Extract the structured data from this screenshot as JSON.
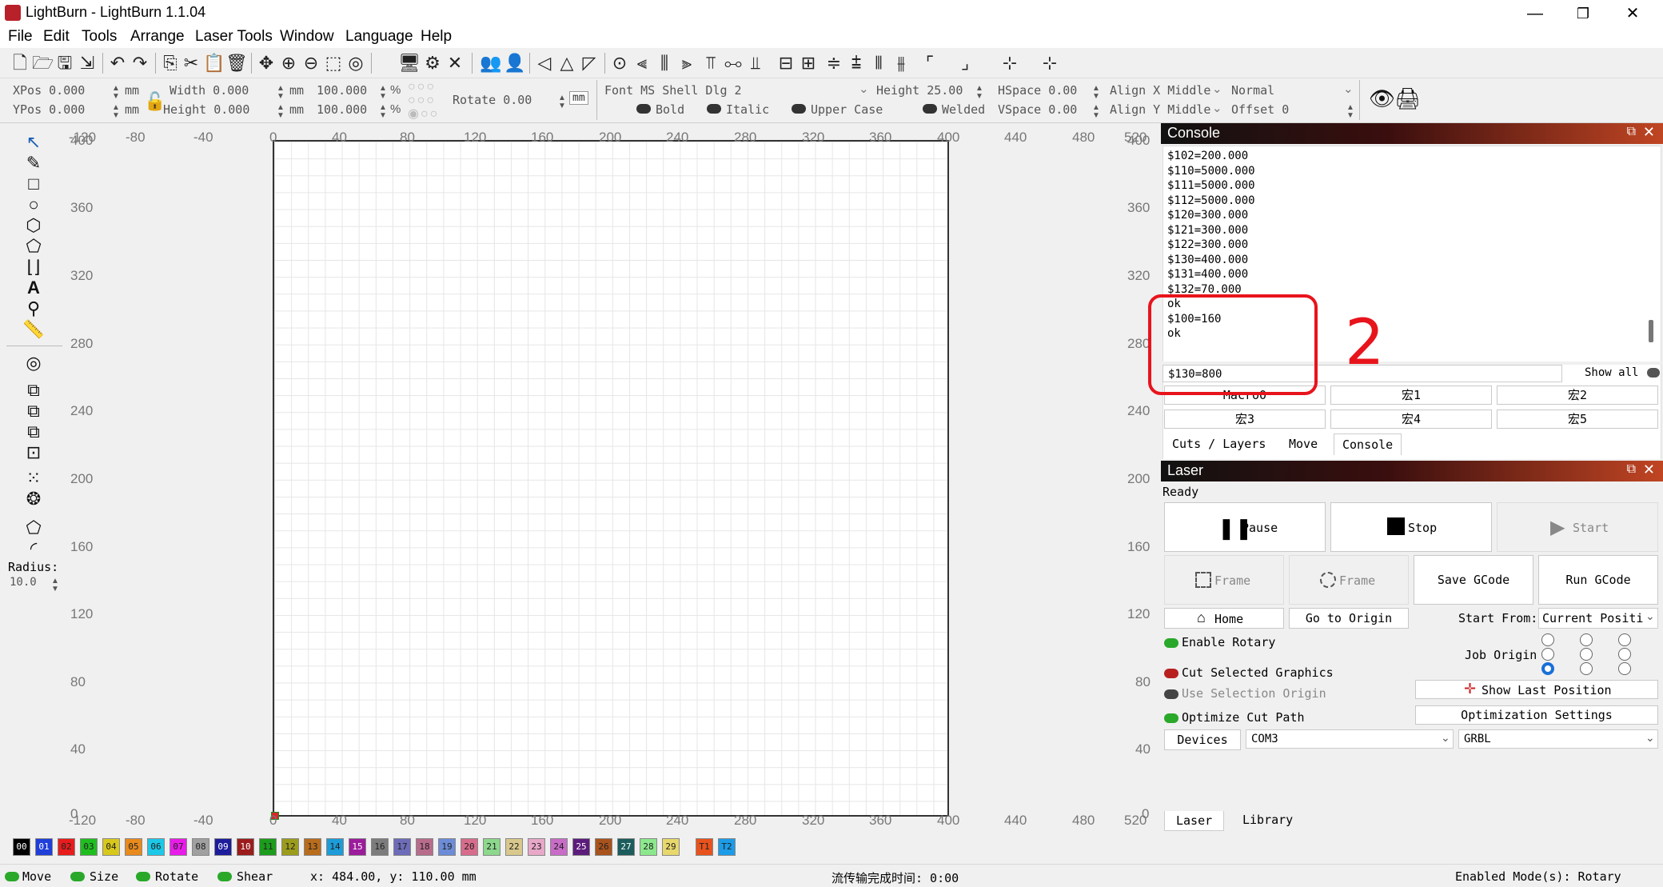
{
  "window": {
    "title": "LightBurn - LightBurn 1.1.04",
    "minimize": "—",
    "maximize": "❐",
    "close": "✕"
  },
  "menu": [
    "File",
    "Edit",
    "Tools",
    "Arrange",
    "Laser Tools",
    "Window",
    "Language",
    "Help"
  ],
  "props": {
    "xpos": "XPos 0.000",
    "ypos": "YPos 0.000",
    "width": "Width 0.000",
    "height": "Height 0.000",
    "unit": "mm",
    "wpct": "100.000",
    "hpct": "100.000",
    "pct": "%",
    "rotate": "Rotate 0.00",
    "mm_btn": "mm",
    "font": "Font MS Shell Dlg 2",
    "text_height": "Height 25.00",
    "hspace": "HSpace 0.00",
    "vspace": "VSpace 0.00",
    "align_x": "Align X Middle",
    "align_y": "Align Y Middle",
    "mode": "Normal",
    "offset": "Offset 0",
    "bold": "Bold",
    "italic": "Italic",
    "upper": "Upper Case",
    "welded": "Welded"
  },
  "tools": {
    "radius_label": "Radius:",
    "radius_value": "10.0"
  },
  "ruler": {
    "top": [
      "-120",
      "-80",
      "-40",
      "0",
      "40",
      "80",
      "120",
      "160",
      "200",
      "240",
      "280",
      "320",
      "360",
      "400",
      "440",
      "480",
      "520"
    ],
    "left": [
      "400",
      "360",
      "320",
      "280",
      "240",
      "200",
      "160",
      "120",
      "80",
      "40",
      "0"
    ]
  },
  "console": {
    "title": "Console",
    "lines": [
      "$102=200.000",
      "$110=5000.000",
      "$111=5000.000",
      "$112=5000.000",
      "$120=300.000",
      "$121=300.000",
      "$122=300.000",
      "$130=400.000",
      "$131=400.000",
      "$132=70.000",
      "ok",
      "$100=160",
      "ok"
    ],
    "input": "$130=800",
    "show_all": "Show all",
    "macros": [
      "Macro0",
      "宏1",
      "宏2",
      "宏3",
      "宏4",
      "宏5"
    ],
    "tabs": [
      "Cuts / Layers",
      "Move",
      "Console"
    ]
  },
  "annotation": {
    "number": "2"
  },
  "laser": {
    "title": "Laser",
    "status": "Ready",
    "pause": "Pause",
    "stop": "Stop",
    "start": "Start",
    "frame1": "Frame",
    "frame2": "Frame",
    "save_gcode": "Save GCode",
    "run_gcode": "Run GCode",
    "home": "Home",
    "go_origin": "Go to Origin",
    "start_from": "Start From:",
    "start_from_value": "Current Positi",
    "enable_rotary": "Enable Rotary",
    "job_origin": "Job Origin",
    "cut_selected": "Cut Selected Graphics",
    "use_selection_origin": "Use Selection Origin",
    "show_last_position": "Show Last Position",
    "optimize_cut_path": "Optimize Cut Path",
    "optimization_settings": "Optimization Settings",
    "devices": "Devices",
    "port": "COM3",
    "controller": "GRBL",
    "tabs": [
      "Laser",
      "Library"
    ]
  },
  "palette": [
    {
      "label": "00",
      "color": "#000000"
    },
    {
      "label": "01",
      "color": "#1f3fd8"
    },
    {
      "label": "02",
      "color": "#e81c1c"
    },
    {
      "label": "03",
      "color": "#1fbe1f"
    },
    {
      "label": "04",
      "color": "#d8c81c"
    },
    {
      "label": "05",
      "color": "#e88a1c"
    },
    {
      "label": "06",
      "color": "#1cc8e8"
    },
    {
      "label": "07",
      "color": "#e81ce8"
    },
    {
      "label": "08",
      "color": "#a0a0a0"
    },
    {
      "label": "09",
      "color": "#1c1c9c"
    },
    {
      "label": "10",
      "color": "#9c1c1c"
    },
    {
      "label": "11",
      "color": "#1c9c1c"
    },
    {
      "label": "12",
      "color": "#9c9c1c"
    },
    {
      "label": "13",
      "color": "#b86c1c"
    },
    {
      "label": "14",
      "color": "#1c9cd8"
    },
    {
      "label": "15",
      "color": "#9c1c9c"
    },
    {
      "label": "16",
      "color": "#7c7c7c"
    },
    {
      "label": "17",
      "color": "#6c6cb8"
    },
    {
      "label": "18",
      "color": "#b86c8c"
    },
    {
      "label": "19",
      "color": "#6c8cd8"
    },
    {
      "label": "20",
      "color": "#d86c8c"
    },
    {
      "label": "21",
      "color": "#8cd88c"
    },
    {
      "label": "22",
      "color": "#d8c88c"
    },
    {
      "label": "23",
      "color": "#e8a8c8"
    },
    {
      "label": "24",
      "color": "#c86cc8"
    },
    {
      "label": "25",
      "color": "#5c1c7c"
    },
    {
      "label": "26",
      "color": "#a8521c"
    },
    {
      "label": "27",
      "color": "#1c5c5c"
    },
    {
      "label": "28",
      "color": "#8ce88c"
    },
    {
      "label": "29",
      "color": "#e8d86c"
    },
    {
      "label": "T1",
      "color": "#e8521c"
    },
    {
      "label": "T2",
      "color": "#1c9ce8"
    }
  ],
  "status": {
    "move": "Move",
    "size": "Size",
    "rotate": "Rotate",
    "shear": "Shear",
    "coords": "x: 484.00, y: 110.00 mm",
    "transfer": "流传输完成时间: 0:00",
    "mode": "Enabled Mode(s): Rotary"
  }
}
